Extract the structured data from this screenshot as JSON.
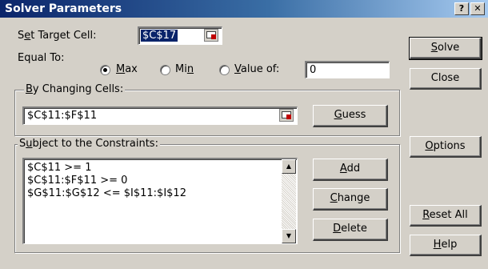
{
  "window": {
    "title": "Solver Parameters",
    "help_glyph": "?",
    "close_glyph": "✕"
  },
  "target": {
    "label_pre": "S",
    "label_key": "e",
    "label_post": "t Target Cell:",
    "value": "$C$17"
  },
  "equal_to": {
    "label": "Equal To:",
    "max_key": "M",
    "max_rest": "ax",
    "min_pre": "Mi",
    "min_key": "n",
    "value_key": "V",
    "value_rest": "alue of:",
    "value_field": "0",
    "selected": "Max"
  },
  "changing": {
    "legend_key": "B",
    "legend_rest": "y Changing Cells:",
    "value": "$C$11:$F$11",
    "guess_key": "G",
    "guess_rest": "uess"
  },
  "constraints": {
    "legend_pre": "S",
    "legend_key": "u",
    "legend_rest": "bject to the Constraints:",
    "items": [
      "$C$11 >= 1",
      "$C$11:$F$11 >= 0",
      "$G$11:$G$12 <= $I$11:$I$12"
    ],
    "add_key": "A",
    "add_rest": "dd",
    "change_key": "C",
    "change_rest": "hange",
    "delete_key": "D",
    "delete_rest": "elete"
  },
  "side_buttons": {
    "solve_key": "S",
    "solve_rest": "olve",
    "close": "Close",
    "options_key": "O",
    "options_rest": "ptions",
    "reset_key": "R",
    "reset_rest": "eset All",
    "help_key": "H",
    "help_rest": "elp"
  },
  "icons": [
    "refedit-icon",
    "radio-selected-icon",
    "scroll-up-icon",
    "scroll-down-icon"
  ]
}
